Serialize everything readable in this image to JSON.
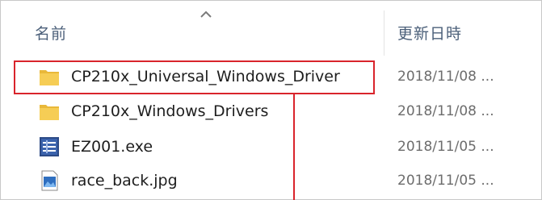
{
  "columns": {
    "name": "名前",
    "date_modified": "更新日時"
  },
  "sort": {
    "icon": "chevron-up-icon",
    "direction": "ascending"
  },
  "files": [
    {
      "name": "CP210x_Universal_Windows_Driver",
      "date": "2018/11/08 ...",
      "icon": "folder-icon"
    },
    {
      "name": "CP210x_Windows_Drivers",
      "date": "2018/11/08 ...",
      "icon": "folder-icon"
    },
    {
      "name": "EZ001.exe",
      "date": "2018/11/05 ...",
      "icon": "exe-app-icon"
    },
    {
      "name": "race_back.jpg",
      "date": "2018/11/05 ...",
      "icon": "image-file-icon"
    }
  ],
  "annotation": {
    "color": "#d9242c",
    "highlighted_item": "CP210x_Universal_Windows_Driver"
  },
  "colors": {
    "header_text": "#4c607a",
    "item_text": "#1e1e1e",
    "date_text": "#6d6d6d",
    "folder": "#f3c84d",
    "highlight": "#d9242c"
  }
}
